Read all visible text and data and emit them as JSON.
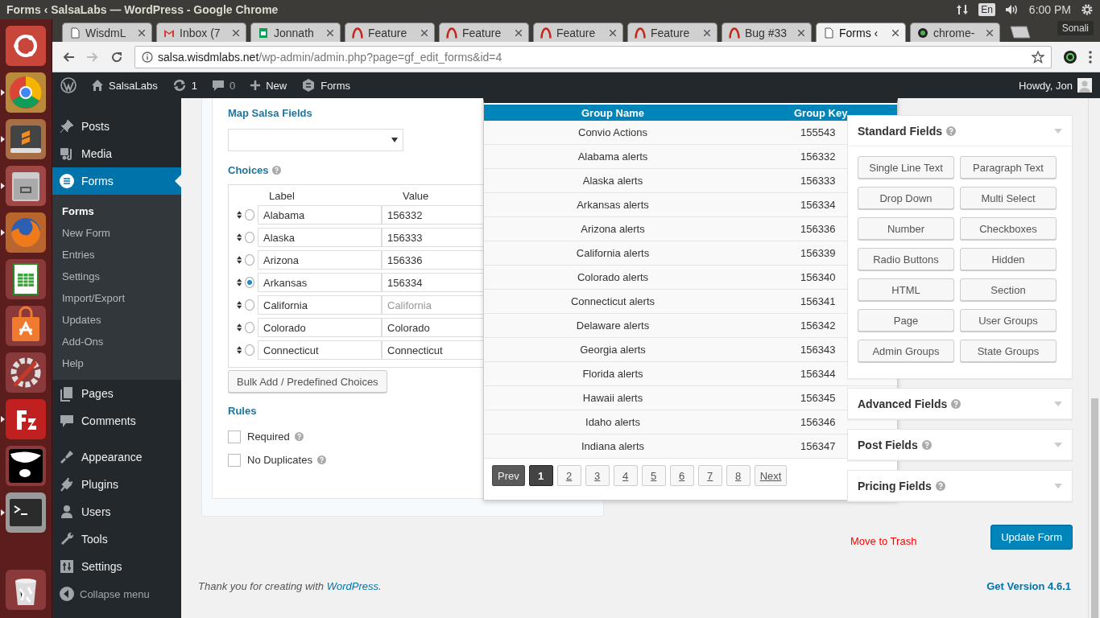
{
  "os_bar": {
    "title": "Forms ‹ SalsaLabs — WordPress - Google Chrome",
    "keyboard": "En",
    "time": "6:00 PM"
  },
  "launcher": [
    {
      "kind": "ubuntu",
      "running": false
    },
    {
      "kind": "chrome",
      "running": true
    },
    {
      "kind": "sublime",
      "running": true
    },
    {
      "kind": "files",
      "running": true
    },
    {
      "kind": "firefox",
      "running": true
    },
    {
      "kind": "calc",
      "running": false
    },
    {
      "kind": "store",
      "running": false
    },
    {
      "kind": "settings",
      "running": false
    },
    {
      "kind": "filezilla",
      "running": true
    },
    {
      "kind": "pirate",
      "running": false
    },
    {
      "kind": "terminal",
      "running": true
    },
    {
      "kind": "trash",
      "running": false
    }
  ],
  "browser": {
    "tabs": [
      {
        "title": "WisdmL",
        "kind": "doc",
        "selected": false
      },
      {
        "title": "Inbox (7",
        "kind": "mail",
        "selected": false
      },
      {
        "title": "Jonnath",
        "kind": "sheet",
        "selected": false
      },
      {
        "title": "Feature",
        "kind": "arc",
        "selected": false
      },
      {
        "title": "Feature",
        "kind": "arc",
        "selected": false
      },
      {
        "title": "Feature",
        "kind": "arc",
        "selected": false
      },
      {
        "title": "Feature",
        "kind": "arc",
        "selected": false
      },
      {
        "title": "Bug #33",
        "kind": "arc",
        "selected": false
      },
      {
        "title": "Forms ‹",
        "kind": "doc",
        "selected": true
      },
      {
        "title": "chrome-",
        "kind": "circle",
        "selected": false
      }
    ],
    "profile": "Sonali",
    "url_host": "salsa.wisdmlabs.net",
    "url_path": "/wp-admin/admin.php?page=gf_edit_forms&id=4"
  },
  "admin_bar": {
    "site": "SalsaLabs",
    "updates": "1",
    "comments": "0",
    "new": "New",
    "forms": "Forms",
    "greeting": "Howdy, Jon"
  },
  "sidebar": {
    "items": [
      {
        "label": "Posts",
        "kind": "pin",
        "selected": false
      },
      {
        "label": "Media",
        "kind": "media",
        "selected": false
      },
      {
        "label": "Forms",
        "kind": "forms",
        "selected": true,
        "children": [
          {
            "label": "Forms",
            "selected": true
          },
          {
            "label": "New Form",
            "selected": false
          },
          {
            "label": "Entries",
            "selected": false
          },
          {
            "label": "Settings",
            "selected": false
          },
          {
            "label": "Import/Export",
            "selected": false
          },
          {
            "label": "Updates",
            "selected": false
          },
          {
            "label": "Add-Ons",
            "selected": false
          },
          {
            "label": "Help",
            "selected": false
          }
        ]
      },
      {
        "label": "Pages",
        "kind": "pages",
        "selected": false
      },
      {
        "label": "Comments",
        "kind": "comments",
        "selected": false
      },
      {
        "label": "Appearance",
        "kind": "appearance",
        "selected": false
      },
      {
        "label": "Plugins",
        "kind": "plugins",
        "selected": false
      },
      {
        "label": "Users",
        "kind": "users",
        "selected": false
      },
      {
        "label": "Tools",
        "kind": "tools",
        "selected": false
      },
      {
        "label": "Settings",
        "kind": "settings",
        "selected": false
      }
    ],
    "collapse": "Collapse menu"
  },
  "field_settings": {
    "map_heading": "Map Salsa Fields",
    "choices_heading": "Choices",
    "choices_columns": [
      "Label",
      "Value"
    ],
    "choices": [
      {
        "label": "Alabama",
        "value": "156332",
        "selected": false
      },
      {
        "label": "Alaska",
        "value": "156333",
        "selected": false
      },
      {
        "label": "Arizona",
        "value": "156336",
        "selected": false
      },
      {
        "label": "Arkansas",
        "value": "156334",
        "selected": true
      },
      {
        "label": "California",
        "placeholder": "California",
        "selected": false
      },
      {
        "label": "Colorado",
        "value": "Colorado",
        "selected": false
      },
      {
        "label": "Connecticut",
        "value": "Connecticut",
        "selected": false
      }
    ],
    "bulk_button": "Bulk Add / Predefined Choices",
    "rules_heading": "Rules",
    "rules": [
      {
        "label": "Required",
        "checked": false
      },
      {
        "label": "No Duplicates",
        "checked": false
      }
    ]
  },
  "group_popup": {
    "columns": [
      "Group Name",
      "Group Key"
    ],
    "rows": [
      {
        "name": "Convio Actions",
        "key": "155543"
      },
      {
        "name": "Alabama alerts",
        "key": "156332"
      },
      {
        "name": "Alaska alerts",
        "key": "156333"
      },
      {
        "name": "Arkansas alerts",
        "key": "156334"
      },
      {
        "name": "Arizona alerts",
        "key": "156336"
      },
      {
        "name": "California alerts",
        "key": "156339"
      },
      {
        "name": "Colorado alerts",
        "key": "156340"
      },
      {
        "name": "Connecticut alerts",
        "key": "156341"
      },
      {
        "name": "Delaware alerts",
        "key": "156342"
      },
      {
        "name": "Georgia alerts",
        "key": "156343"
      },
      {
        "name": "Florida alerts",
        "key": "156344"
      },
      {
        "name": "Hawaii alerts",
        "key": "156345"
      },
      {
        "name": "Idaho alerts",
        "key": "156346"
      },
      {
        "name": "Indiana alerts",
        "key": "156347"
      }
    ],
    "pages": [
      {
        "label": "Prev",
        "selected": false,
        "disabled": true
      },
      {
        "label": "1",
        "selected": true,
        "disabled": false
      },
      {
        "label": "2",
        "selected": false,
        "disabled": false
      },
      {
        "label": "3",
        "selected": false,
        "disabled": false
      },
      {
        "label": "4",
        "selected": false,
        "disabled": false
      },
      {
        "label": "5",
        "selected": false,
        "disabled": false
      },
      {
        "label": "6",
        "selected": false,
        "disabled": false
      },
      {
        "label": "7",
        "selected": false,
        "disabled": false
      },
      {
        "label": "8",
        "selected": false,
        "disabled": false
      },
      {
        "label": "Next",
        "selected": false,
        "disabled": false
      }
    ]
  },
  "field_groups": [
    {
      "title": "Standard Fields",
      "expanded": true,
      "buttons": [
        "Single Line Text",
        "Paragraph Text",
        "Drop Down",
        "Multi Select",
        "Number",
        "Checkboxes",
        "Radio Buttons",
        "Hidden",
        "HTML",
        "Section",
        "Page",
        "User Groups",
        "Admin Groups",
        "State Groups"
      ]
    },
    {
      "title": "Advanced Fields",
      "expanded": false
    },
    {
      "title": "Post Fields",
      "expanded": false
    },
    {
      "title": "Pricing Fields",
      "expanded": false
    }
  ],
  "actions": {
    "trash": "Move to Trash",
    "update": "Update Form"
  },
  "footer": {
    "before": "Thank you for creating with ",
    "link": "WordPress",
    "after": ".",
    "version": "Get Version 4.6.1"
  }
}
